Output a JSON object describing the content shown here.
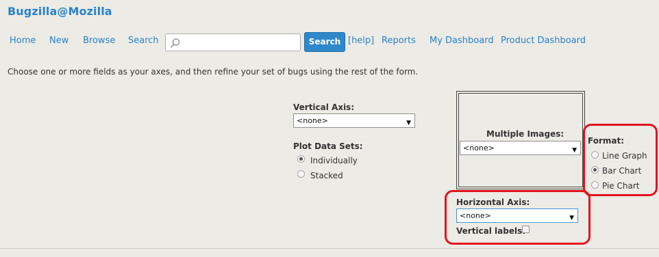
{
  "header": {
    "brand": "Bugzilla@Mozilla"
  },
  "nav": {
    "home": "Home",
    "new": "New",
    "browse": "Browse",
    "search": "Search",
    "search_button": "Search",
    "help": "[help]",
    "reports": "Reports",
    "my_dashboard": "My Dashboard",
    "product_dashboard": "Product Dashboard",
    "search_value": ""
  },
  "intro": "Choose one or more fields as your axes, and then refine your set of bugs using the rest of the form.",
  "form": {
    "vertical_axis": {
      "label": "Vertical Axis:",
      "value": "<none>"
    },
    "plot_data_sets": {
      "label": "Plot Data Sets:",
      "options": [
        {
          "label": "Individually",
          "selected": true
        },
        {
          "label": "Stacked",
          "selected": false
        }
      ]
    },
    "multiple_images": {
      "label": "Multiple Images:",
      "value": "<none>"
    },
    "format": {
      "label": "Format:",
      "options": [
        {
          "label": "Line Graph",
          "selected": false
        },
        {
          "label": "Bar Chart",
          "selected": true
        },
        {
          "label": "Pie Chart",
          "selected": false
        }
      ]
    },
    "horizontal_axis": {
      "label": "Horizontal Axis:",
      "value": "<none>"
    },
    "vertical_labels": {
      "label": "Vertical labels:",
      "checked": false
    }
  },
  "colors": {
    "link": "#2a82c9",
    "button": "#2f88c9",
    "highlight": "#e0141e",
    "background": "#ecebe5"
  },
  "icons": {
    "search": "magnifier-icon",
    "dropdown": "triangle-down-icon"
  }
}
